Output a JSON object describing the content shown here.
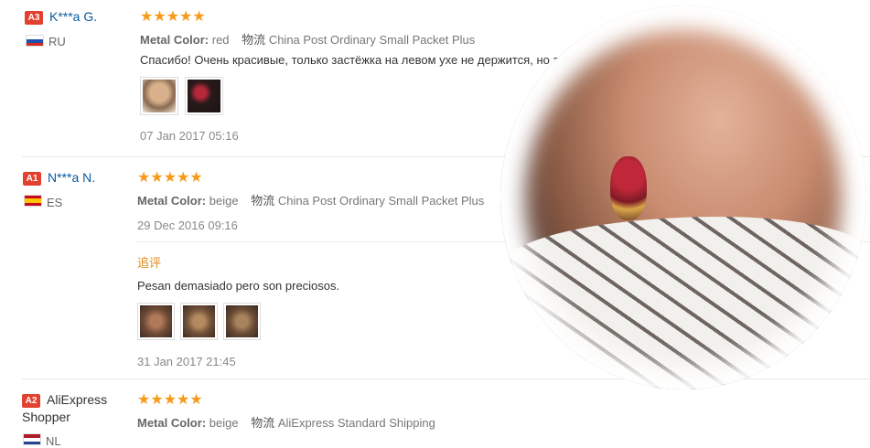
{
  "reviews": [
    {
      "badge": "A3",
      "name": "K***a G.",
      "country": "RU",
      "stars": "★★★★★",
      "metal_label": "Metal Color:",
      "metal_value": "red",
      "ship_label": "物流",
      "ship_value": "China Post Ordinary Small Packet Plus",
      "text": "Спасибо! Очень красивые, только застёжка на левом ухе не держится, но з",
      "date": "07 Jan 2017 05:16"
    },
    {
      "badge": "A1",
      "name": "N***a N.",
      "country": "ES",
      "stars": "★★★★★",
      "metal_label": "Metal Color:",
      "metal_value": "beige",
      "ship_label": "物流",
      "ship_value": "China Post Ordinary Small Packet Plus",
      "date": "29 Dec 2016 09:16",
      "followup_label": "追评",
      "followup_text": "Pesan demasiado pero son preciosos.",
      "followup_date": "31 Jan 2017 21:45"
    },
    {
      "badge": "A2",
      "name_line1": "AliExpress",
      "name_line2": "Shopper",
      "country": "NL",
      "stars": "★★★★★",
      "metal_label": "Metal Color:",
      "metal_value": "beige",
      "ship_label": "物流",
      "ship_value": "AliExpress Standard Shipping"
    }
  ],
  "colors": {
    "badge": "#e2412f",
    "stars": "#f79a18",
    "name_link": "#0b5aa2",
    "followup": "#e08a1e"
  }
}
